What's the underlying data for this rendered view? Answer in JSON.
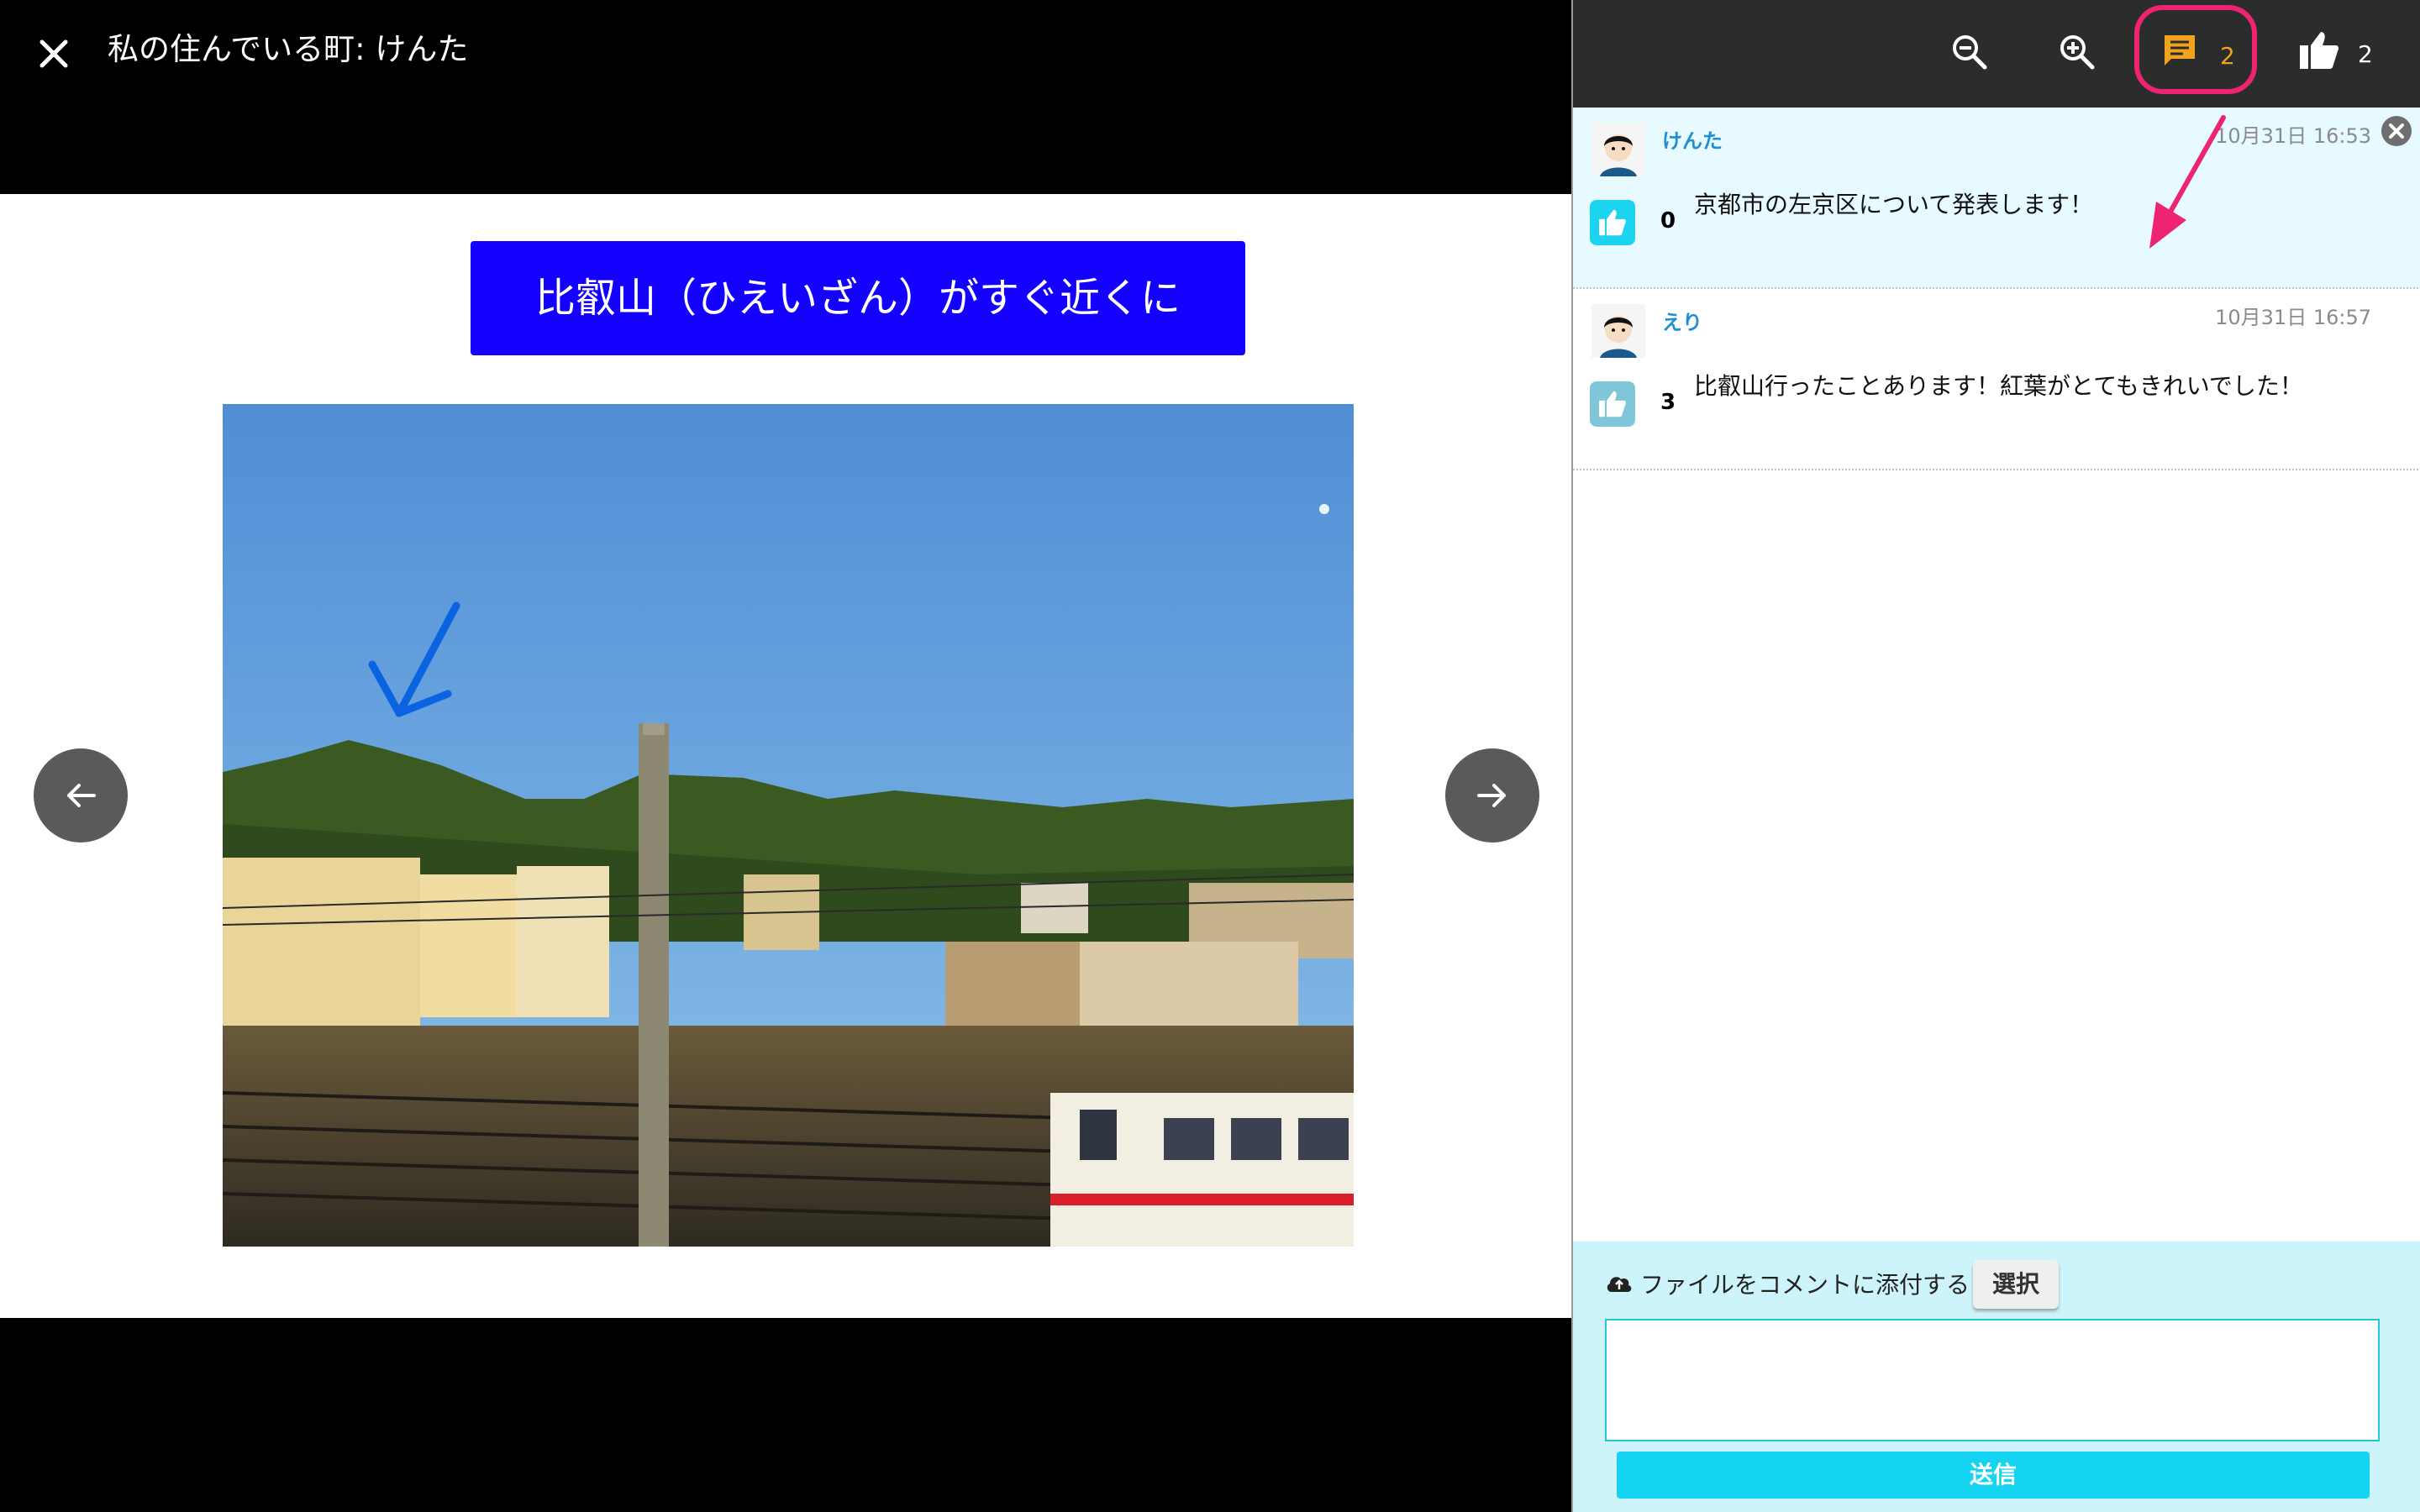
{
  "viewer": {
    "title": "私の住んでいる町: けんた",
    "slide_caption": "比叡山（ひえいざん）がすぐ近くに",
    "photo_description": "mountain view over railway yard with Keihan train"
  },
  "toolbar": {
    "comments_count": "2",
    "likes_count": "2"
  },
  "comments": [
    {
      "author": "けんた",
      "timestamp": "10月31日 16:53",
      "likes": "0",
      "text": "京都市の左京区について発表します！"
    },
    {
      "author": "えり",
      "timestamp": "10月31日 16:57",
      "likes": "3",
      "text": "比叡山行ったことあります！紅葉がとてもきれいでした！"
    }
  ],
  "composer": {
    "attach_label": "ファイルをコメントに添付する",
    "select_label": "選択",
    "send_label": "送信",
    "input_value": ""
  },
  "colors": {
    "caption_bg": "#1400ff",
    "highlight": "#ef2470",
    "accent": "#15d4f2"
  }
}
